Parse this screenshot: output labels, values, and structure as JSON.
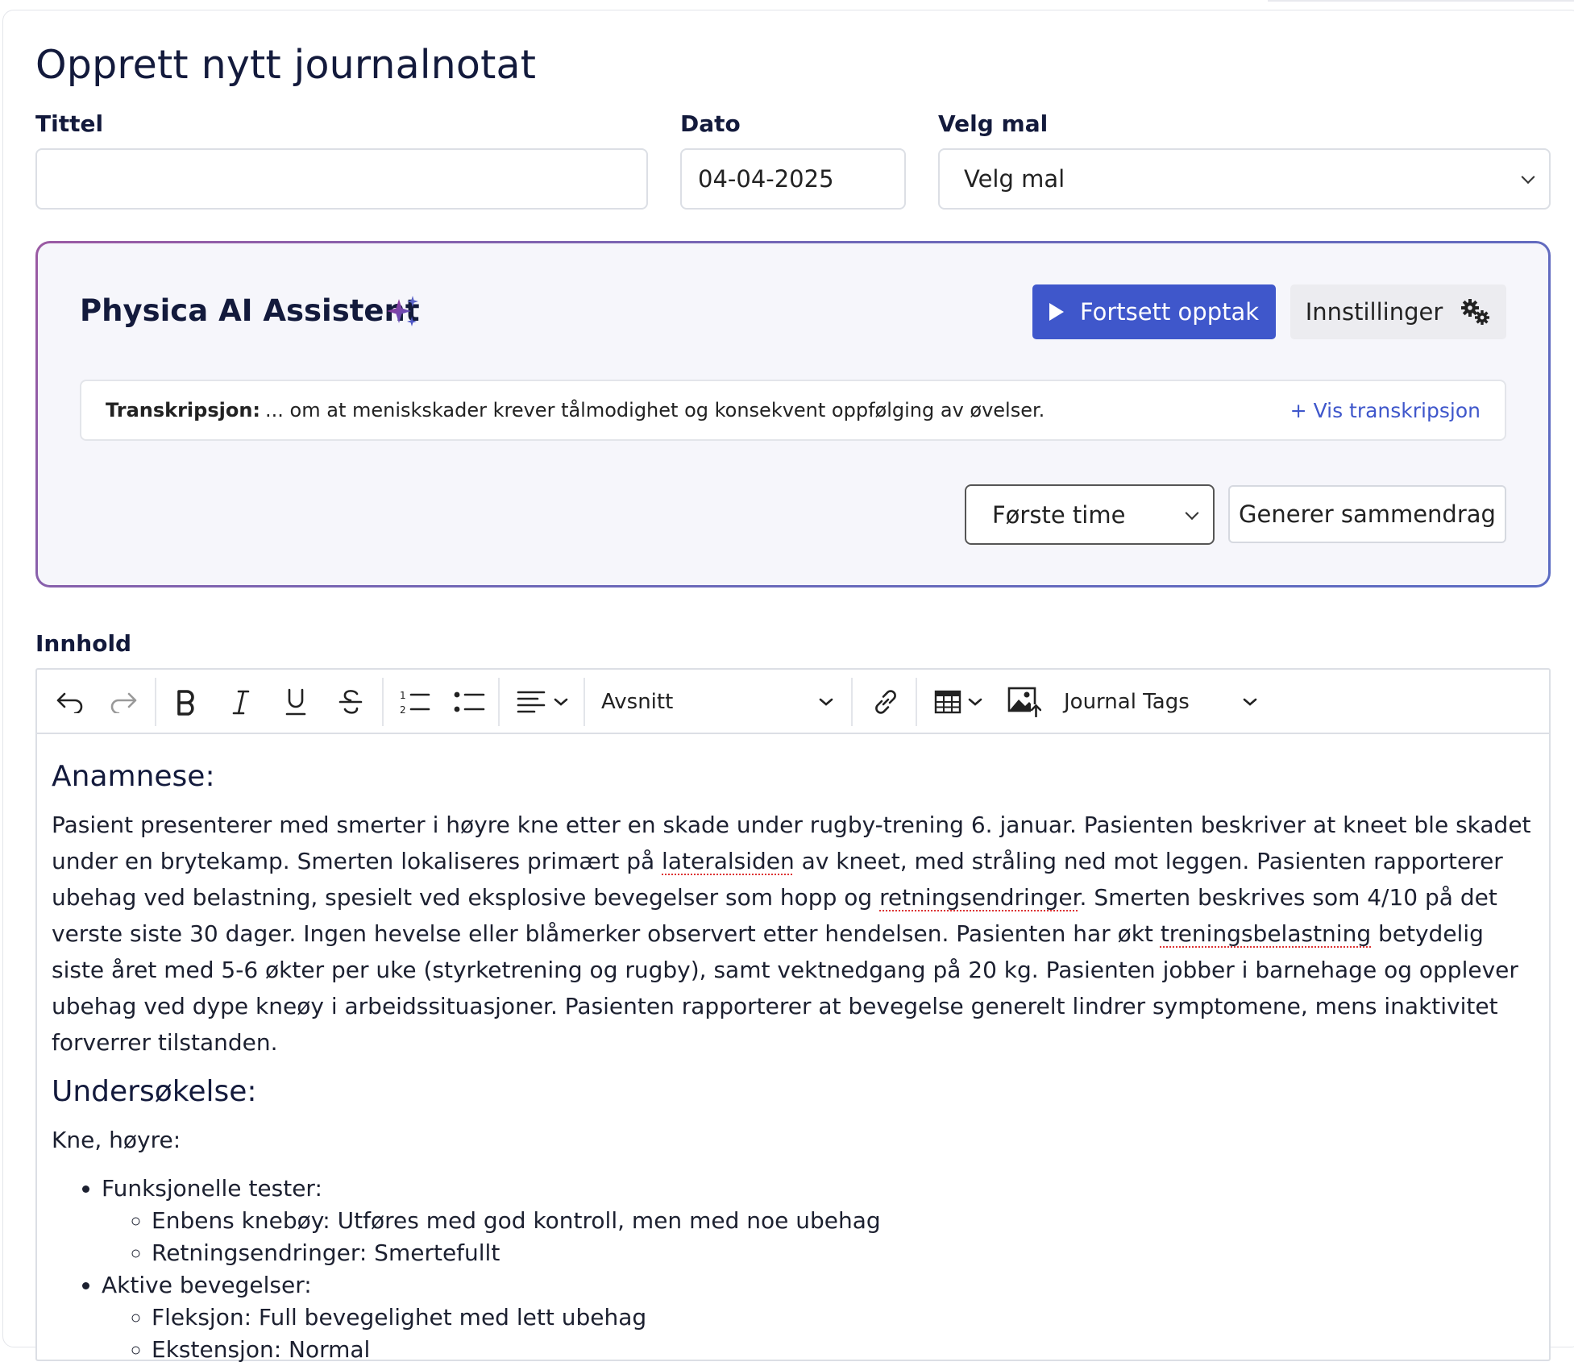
{
  "page": {
    "title": "Opprett nytt journalnotat"
  },
  "form": {
    "title_label": "Tittel",
    "title_value": "",
    "date_label": "Dato",
    "date_value": "04-04-2025",
    "template_label": "Velg mal",
    "template_value": "Velg mal"
  },
  "ai_assistant": {
    "title": "Physica AI Assistent",
    "record_button": "Fortsett opptak",
    "settings_button": "Innstillinger",
    "transcript_label": "Transkripsjon:",
    "transcript_text": "... om at menisk­skader krever tålmodighet og konsekvent oppfølging av øvelser.",
    "show_transcript_link": "+ Vis transkripsjon",
    "session_select_value": "Første time",
    "generate_button": "Generer sammendrag",
    "accent_color": "#3f57cb"
  },
  "content": {
    "label": "Innhold",
    "toolbar": {
      "block_format": "Avsnitt",
      "tags_menu": "Journal Tags"
    },
    "anamnese_heading": "Anamnese:",
    "anamnese_p1": "Pasient presenterer med smerter i høyre kne etter en skade under rugby-trening 6. januar. Pasienten beskriver at kneet ble skadet under en brytekamp. Smerten lokaliseres primært på ",
    "anamnese_w1": "lateralsiden",
    "anamnese_p2": " av kneet, med stråling ned mot leggen. Pasienten rapporterer ubehag ved belastning, spesielt ved eksplosive bevegelser som hopp og ",
    "anamnese_w2": "retningsendringer",
    "anamnese_p3": ". Smerten beskrives som 4/10 på det verste siste 30 dager. Ingen hevelse eller blåmerker observert etter hendelsen. Pasienten har økt ",
    "anamnese_w3": "treningsbelastning",
    "anamnese_p4": " betydelig siste året med 5-6 økter per uke (styrketrening og rugby), samt vektnedgang på 20 kg. Pasienten jobber i barnehage og opplever ubehag ved dype kneøy i arbeidssituasjoner. Pasienten rapporterer at bevegelse generelt lindrer symptomene, mens inaktivitet forverrer tilstanden.",
    "undersokelse_heading": "Undersøkelse:",
    "knee_line": "Kne, høyre:",
    "sections": [
      {
        "title": "Funksjonelle tester:",
        "items": [
          "Enbens knebøy: Utføres med god kontroll, men med noe ubehag",
          "Retningsendringer: Smertefullt"
        ]
      },
      {
        "title": "Aktive bevegelser:",
        "items": [
          "Fleksjon: Full bevegelighet med lett ubehag",
          "Ekstensjon: Normal"
        ]
      }
    ]
  }
}
